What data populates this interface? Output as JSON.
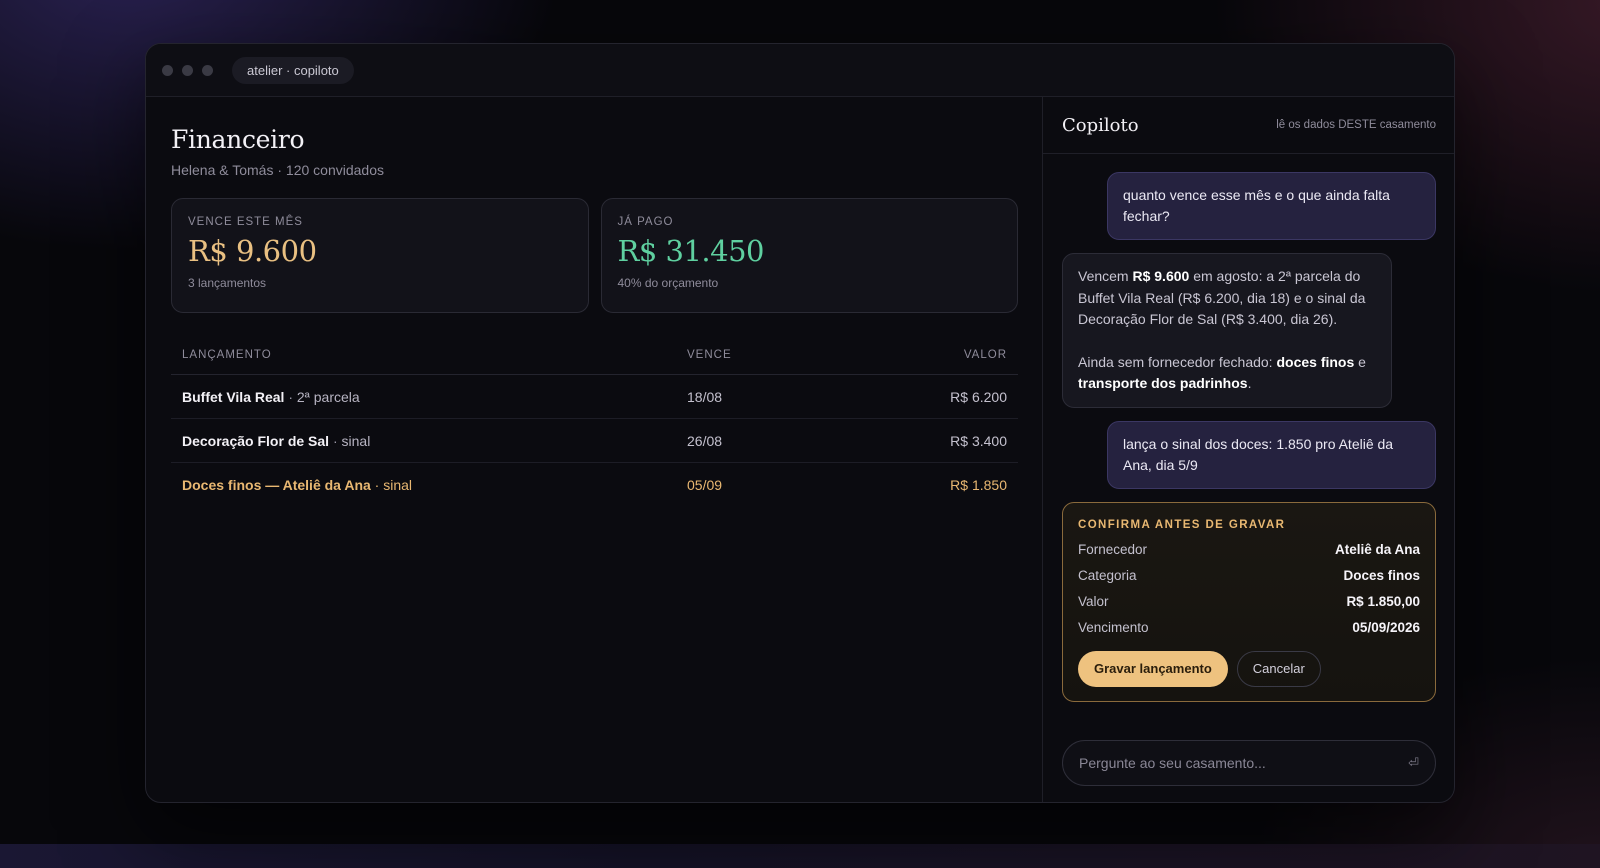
{
  "window": {
    "tab_label": "atelier · copiloto"
  },
  "finance": {
    "title": "Financeiro",
    "subtitle": "Helena & Tomás · 120 convidados",
    "cards": [
      {
        "label": "VENCE ESTE MÊS",
        "value": "R$ 9.600",
        "note": "3 lançamentos",
        "color": "#e9c082"
      },
      {
        "label": "JÁ PAGO",
        "value": "R$ 31.450",
        "note": "40% do orçamento",
        "color": "#5fd0a0"
      }
    ],
    "table": {
      "headers": {
        "name": "LANÇAMENTO",
        "due": "VENCE",
        "value": "VALOR"
      },
      "rows": [
        {
          "name": "Buffet Vila Real",
          "sep": " · ",
          "kind": "2ª parcela",
          "due": "18/08",
          "value": "R$ 6.200"
        },
        {
          "name": "Decoração Flor de Sal",
          "sep": " · ",
          "kind": "sinal",
          "due": "26/08",
          "value": "R$ 3.400"
        },
        {
          "name": "Doces finos — Ateliê da Ana",
          "sep": " · ",
          "kind": "sinal",
          "due": "05/09",
          "value": "R$ 1.850"
        }
      ]
    }
  },
  "copilot": {
    "title": "Copiloto",
    "hint": "lê os dados DESTE casamento",
    "user_msg_1": "quanto vence esse mês e o que ainda falta fechar?",
    "bot_msg": {
      "p1_a": "Vencem ",
      "p1_b": "R$ 9.600",
      "p1_c": " em agosto: a 2ª parcela do Buffet Vila Real (R$ 6.200, dia 18) e o sinal da Decoração Flor de Sal (R$ 3.400, dia 26).",
      "p2_a": "Ainda sem fornecedor fechado: ",
      "p2_b": "doces finos",
      "p2_c": " e ",
      "p2_d": "transporte dos padrinhos",
      "p2_e": "."
    },
    "user_msg_2": "lança o sinal dos doces: 1.850 pro Ateliê da Ana, dia 5/9",
    "confirm": {
      "title": "CONFIRMA ANTES DE GRAVAR",
      "fields": [
        {
          "k": "Fornecedor",
          "v": "Ateliê da Ana"
        },
        {
          "k": "Categoria",
          "v": "Doces finos"
        },
        {
          "k": "Valor",
          "v": "R$ 1.850,00"
        },
        {
          "k": "Vencimento",
          "v": "05/09/2026"
        }
      ],
      "save_label": "Gravar lançamento",
      "cancel_label": "Cancelar"
    },
    "composer": {
      "placeholder": "Pergunte ao seu casamento...",
      "enter_glyph": "⏎"
    }
  },
  "icons": {
    "window_controls": "window-dot-icon",
    "send": "enter-icon"
  }
}
